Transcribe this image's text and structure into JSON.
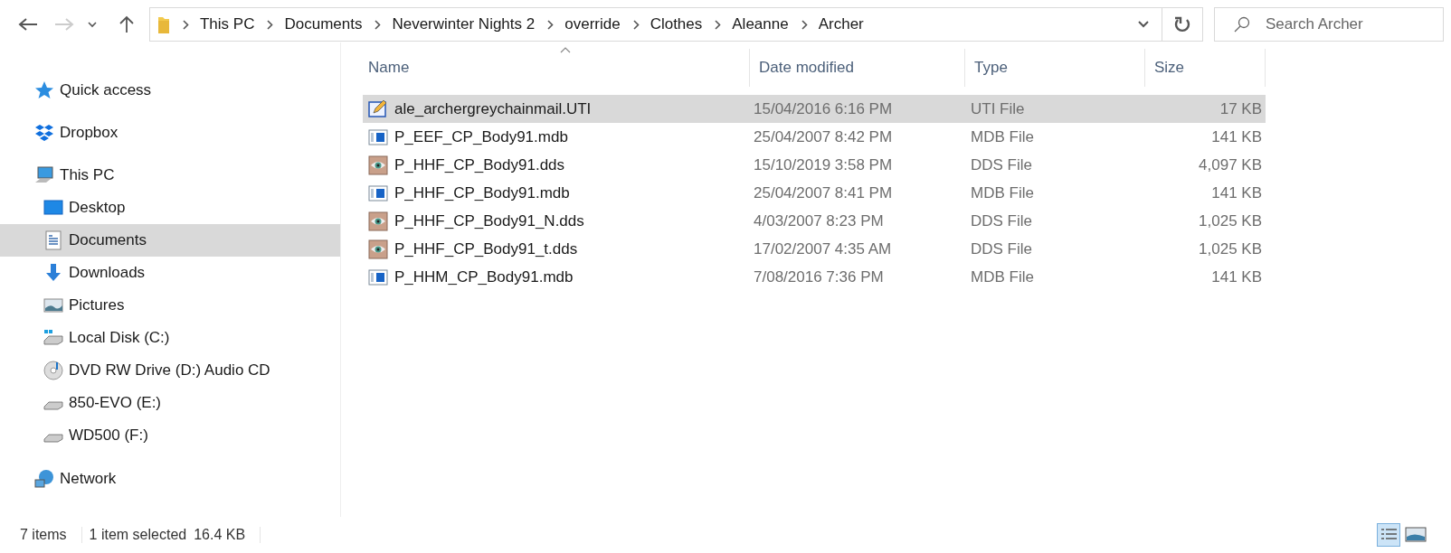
{
  "toolbar": {
    "back_enabled": true,
    "forward_enabled": false
  },
  "address": {
    "crumbs": [
      "This PC",
      "Documents",
      "Neverwinter Nights 2",
      "override",
      "Clothes",
      "Aleanne",
      "Archer"
    ]
  },
  "search": {
    "placeholder": "Search Archer"
  },
  "sidebar": {
    "items": [
      {
        "label": "Quick access",
        "kind": "star",
        "selected": false
      },
      {
        "label": "Dropbox",
        "kind": "dropbox",
        "selected": false
      },
      {
        "label": "This PC",
        "kind": "pc",
        "selected": false,
        "children": [
          {
            "label": "Desktop",
            "kind": "desktop",
            "selected": false
          },
          {
            "label": "Documents",
            "kind": "documents",
            "selected": true
          },
          {
            "label": "Downloads",
            "kind": "downloads",
            "selected": false
          },
          {
            "label": "Pictures",
            "kind": "pictures",
            "selected": false
          },
          {
            "label": "Local Disk (C:)",
            "kind": "sysdisk",
            "selected": false
          },
          {
            "label": "DVD RW Drive (D:) Audio CD",
            "kind": "dvd",
            "selected": false
          },
          {
            "label": "850-EVO (E:)",
            "kind": "disk",
            "selected": false
          },
          {
            "label": "WD500 (F:)",
            "kind": "disk",
            "selected": false
          }
        ]
      },
      {
        "label": "Network",
        "kind": "network",
        "selected": false
      }
    ]
  },
  "table": {
    "columns": [
      "Name",
      "Date modified",
      "Type",
      "Size"
    ],
    "rows": [
      {
        "name": "ale_archergreychainmail.UTI",
        "date": "15/04/2016 6:16 PM",
        "type": "UTI File",
        "size": "17 KB",
        "kind": "uti",
        "selected": true
      },
      {
        "name": "P_EEF_CP_Body91.mdb",
        "date": "25/04/2007 8:42 PM",
        "type": "MDB File",
        "size": "141 KB",
        "kind": "mdb",
        "selected": false
      },
      {
        "name": "P_HHF_CP_Body91.dds",
        "date": "15/10/2019 3:58 PM",
        "type": "DDS File",
        "size": "4,097 KB",
        "kind": "dds",
        "selected": false
      },
      {
        "name": "P_HHF_CP_Body91.mdb",
        "date": "25/04/2007 8:41 PM",
        "type": "MDB File",
        "size": "141 KB",
        "kind": "mdb",
        "selected": false
      },
      {
        "name": "P_HHF_CP_Body91_N.dds",
        "date": "4/03/2007 8:23 PM",
        "type": "DDS File",
        "size": "1,025 KB",
        "kind": "dds",
        "selected": false
      },
      {
        "name": "P_HHF_CP_Body91_t.dds",
        "date": "17/02/2007 4:35 AM",
        "type": "DDS File",
        "size": "1,025 KB",
        "kind": "dds",
        "selected": false
      },
      {
        "name": "P_HHM_CP_Body91.mdb",
        "date": "7/08/2016 7:36 PM",
        "type": "MDB File",
        "size": "141 KB",
        "kind": "mdb",
        "selected": false
      }
    ]
  },
  "status_bar": {
    "item_count": "7 items",
    "selection": "1 item selected",
    "selection_size": "16.4 KB"
  },
  "view_buttons": [
    {
      "kind": "details",
      "selected": true
    },
    {
      "kind": "thumbnails",
      "selected": false
    }
  ]
}
